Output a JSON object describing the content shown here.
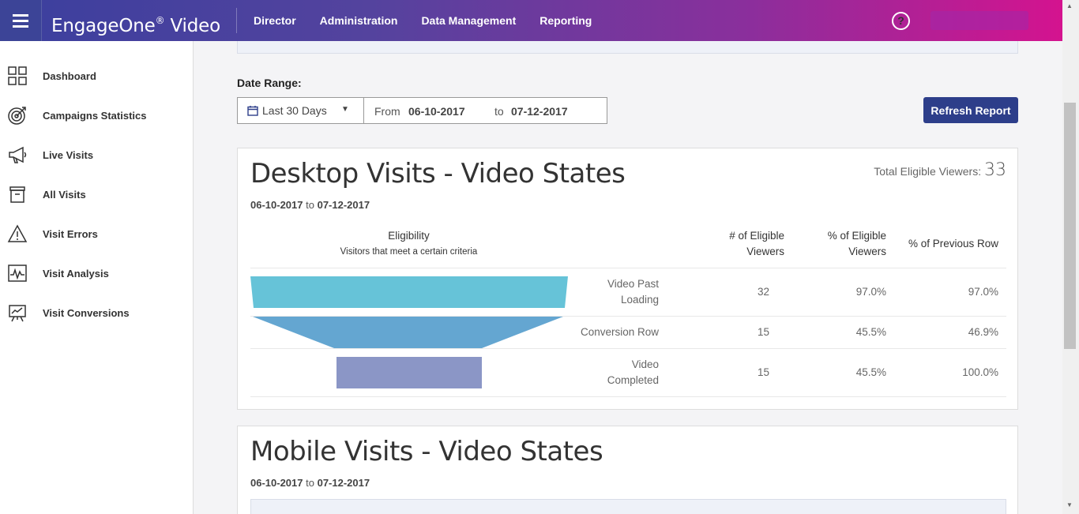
{
  "header": {
    "brand": "EngageOne",
    "brand_mark": "®",
    "brand_suffix": " Video",
    "nav": [
      "Director",
      "Administration",
      "Data Management",
      "Reporting"
    ],
    "help_label": "?"
  },
  "sidebar": {
    "items": [
      {
        "label": "Dashboard",
        "icon": "grid-icon"
      },
      {
        "label": "Campaigns Statistics",
        "icon": "target-icon"
      },
      {
        "label": "Live Visits",
        "icon": "megaphone-icon"
      },
      {
        "label": "All Visits",
        "icon": "archive-icon"
      },
      {
        "label": "Visit Errors",
        "icon": "warning-icon"
      },
      {
        "label": "Visit Analysis",
        "icon": "pulse-icon"
      },
      {
        "label": "Visit Conversions",
        "icon": "presentation-icon"
      }
    ]
  },
  "filters": {
    "date_range_label": "Date Range:",
    "range_value": "Last 30 Days",
    "from_label": "From",
    "from_value": "06-10-2017",
    "to_label": "to",
    "to_value": "07-12-2017",
    "refresh_label": "Refresh Report"
  },
  "desktop": {
    "title": "Desktop Visits - Video States",
    "date_from": "06-10-2017",
    "date_sep": "to",
    "date_to": "07-12-2017",
    "total_label": "Total Eligible Viewers:",
    "total_value": "33",
    "headers": {
      "eligibility": "Eligibility",
      "eligibility_sub": "Visitors that meet a certain criteria",
      "eligible_viewers_1": "# of Eligible",
      "eligible_viewers_2": "Viewers",
      "pct_eligible_1": "% of Eligible",
      "pct_eligible_2": "Viewers",
      "pct_previous": "% of Previous Row"
    },
    "rows": [
      {
        "label_1": "Video Past",
        "label_2": "Loading",
        "count": "32",
        "pct": "97.0%",
        "prev": "97.0%"
      },
      {
        "label_1": "",
        "label_2": "Conversion Row",
        "count": "15",
        "pct": "45.5%",
        "prev": "46.9%"
      },
      {
        "label_1": "Video",
        "label_2": "Completed",
        "count": "15",
        "pct": "45.5%",
        "prev": "100.0%"
      }
    ],
    "funnel_colors": [
      "#66c3d8",
      "#64a6d1",
      "#8b96c6"
    ]
  },
  "mobile": {
    "title": "Mobile Visits - Video States",
    "date_from": "06-10-2017",
    "date_sep": "to",
    "date_to": "07-12-2017"
  }
}
